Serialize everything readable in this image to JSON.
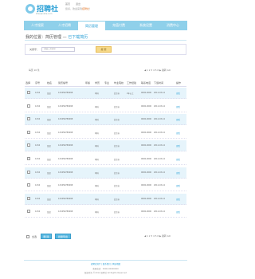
{
  "header": {
    "logo_text": "招聘社",
    "logo_sub": "zhaopinshe.com",
    "top_links": [
      "首页",
      "退出"
    ],
    "welcome_prefix": "您好，欢迎来到",
    "welcome_brand": "招聘社",
    "welcome_suffix": "！"
  },
  "nav": {
    "items": [
      {
        "label": "人才搜索"
      },
      {
        "label": "人才招聘"
      },
      {
        "label": "简历管理"
      },
      {
        "label": "充值付费"
      },
      {
        "label": "系统设置"
      },
      {
        "label": "消费中心"
      }
    ],
    "active_index": 2
  },
  "breadcrumb": {
    "prefix": "我的位置：简历管理 — ",
    "current": "已下载简历"
  },
  "search": {
    "label": "关键字：",
    "placeholder": "请输入关键字",
    "button": "搜 索"
  },
  "pager": {
    "top_left": "每页 10 条",
    "right": "◀ 1 2 3 4 5 6 ▶ 跳转 GO"
  },
  "table": {
    "headers": [
      "选择",
      "序号",
      "姓名",
      "简历编号",
      "年龄",
      "学历",
      "专业",
      "毕业院校",
      "工作经验",
      "联系电话",
      "下载时间",
      "操作"
    ],
    "rows": [
      {
        "id": "1234",
        "name": "某某",
        "resume_no": "123456789098",
        "age": "",
        "edu": "本科",
        "major": "",
        "school": "北京市",
        "exp": "2年以上",
        "phone": "",
        "time": "2012-03-14",
        "op": "查看",
        "date2": "0000-0000"
      },
      {
        "id": "1234",
        "name": "某某",
        "resume_no": "123456789098",
        "age": "",
        "edu": "本科",
        "major": "",
        "school": "北京市",
        "exp": "",
        "phone": "",
        "time": "2012-03-14",
        "op": "查看",
        "date2": "0000-0000"
      },
      {
        "id": "1234",
        "name": "某某",
        "resume_no": "123456789098",
        "age": "",
        "edu": "本科",
        "major": "",
        "school": "北京市",
        "exp": "",
        "phone": "",
        "time": "2012-03-14",
        "op": "查看",
        "date2": "0000-0000"
      },
      {
        "id": "1234",
        "name": "某某",
        "resume_no": "123456789098",
        "age": "",
        "edu": "本科",
        "major": "",
        "school": "北京市",
        "exp": "",
        "phone": "",
        "time": "2012-03-14",
        "op": "查看",
        "date2": "0000-0000"
      },
      {
        "id": "1234",
        "name": "某某",
        "resume_no": "123456789098",
        "age": "",
        "edu": "本科",
        "major": "",
        "school": "北京市",
        "exp": "",
        "phone": "",
        "time": "2012-03-14",
        "op": "查看",
        "date2": "0000-0000"
      },
      {
        "id": "1234",
        "name": "某某",
        "resume_no": "123456789098",
        "age": "",
        "edu": "本科",
        "major": "",
        "school": "北京市",
        "exp": "",
        "phone": "",
        "time": "2012-03-14",
        "op": "查看",
        "date2": "0000-0000"
      },
      {
        "id": "1234",
        "name": "某某",
        "resume_no": "123456789098",
        "age": "",
        "edu": "本科",
        "major": "",
        "school": "北京市",
        "exp": "",
        "phone": "",
        "time": "2012-03-14",
        "op": "查看",
        "date2": "0000-0000"
      },
      {
        "id": "1234",
        "name": "某某",
        "resume_no": "123456789098",
        "age": "",
        "edu": "本科",
        "major": "",
        "school": "北京市",
        "exp": "",
        "phone": "",
        "time": "2012-03-14",
        "op": "查看",
        "date2": "0000-0000"
      },
      {
        "id": "1234",
        "name": "某某",
        "resume_no": "123456789098",
        "age": "",
        "edu": "本科",
        "major": "",
        "school": "北京市",
        "exp": "",
        "phone": "",
        "time": "2012-03-14",
        "op": "查看",
        "date2": "0000-0000"
      },
      {
        "id": "1234",
        "name": "某某",
        "resume_no": "123456789098",
        "age": "",
        "edu": "本科",
        "major": "",
        "school": "北京市",
        "exp": "",
        "phone": "",
        "time": "2012-03-14",
        "op": "查看",
        "date2": "0000-0000"
      }
    ]
  },
  "bottom": {
    "select_all": "全选",
    "delete": "删 除",
    "export": "批量导出"
  },
  "footer": {
    "links": "招聘社简介 | 联系我们 | 网站地图",
    "line2": "客服电话：0000-00000000",
    "line3": "版权所有 ©2012 招聘社 All Rights Reserved"
  },
  "colors": {
    "accent": "#2aa0d6",
    "nav_bg": "#8fd0ea",
    "row_alt": "#e6f4fb",
    "search_btn": "#f6d98a"
  }
}
